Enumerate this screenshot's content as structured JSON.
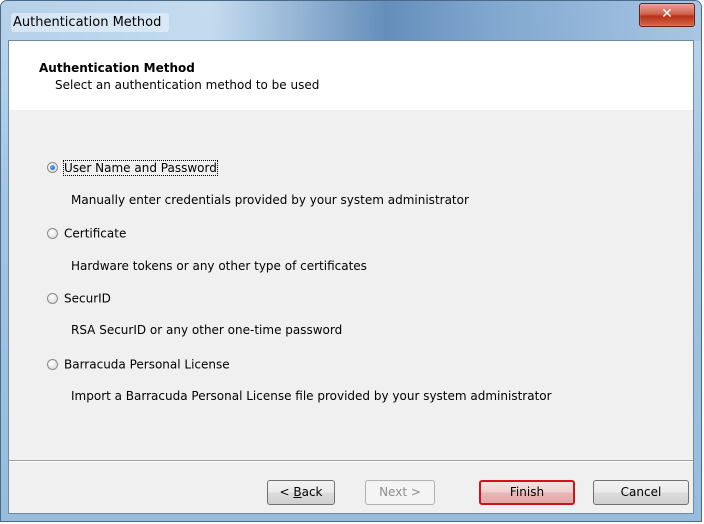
{
  "window": {
    "title": "Authentication Method",
    "close_symbol": "✕"
  },
  "header": {
    "title": "Authentication Method",
    "subtitle": "Select an authentication method to be used"
  },
  "options": [
    {
      "label": "User Name and Password",
      "description": "Manually enter credentials provided by your system administrator",
      "selected": true
    },
    {
      "label": "Certificate",
      "description": "Hardware tokens or any other type of certificates",
      "selected": false
    },
    {
      "label": "SecurID",
      "description": "RSA SecurID or any other one-time password",
      "selected": false
    },
    {
      "label": "Barracuda Personal License",
      "description": "Import a Barracuda Personal License file provided by your system administrator",
      "selected": false
    }
  ],
  "buttons": {
    "back_prefix": "< ",
    "back_key": "B",
    "back_rest": "ack",
    "next": "Next >",
    "finish": "Finish",
    "cancel": "Cancel"
  },
  "colors": {
    "finish_highlight": "#d0121f",
    "close_button": "#c8432b"
  }
}
